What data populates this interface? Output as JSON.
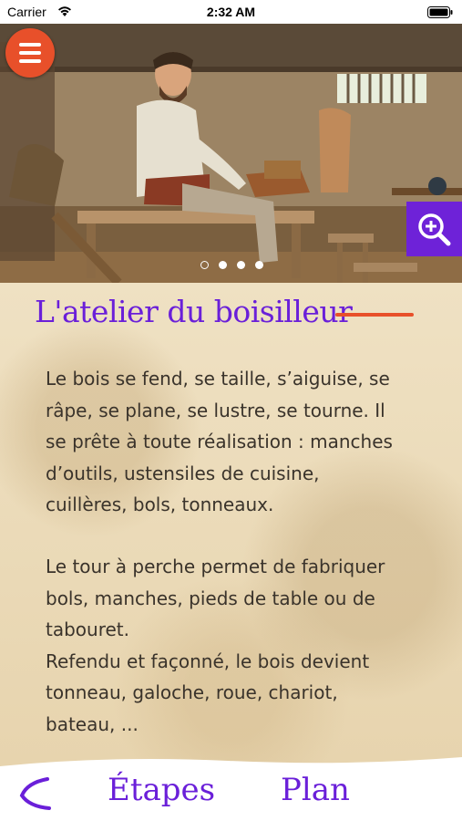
{
  "status_bar": {
    "carrier": "Carrier",
    "time": "2:32 AM"
  },
  "header": {
    "menu_icon": "hamburger-menu-icon",
    "zoom_icon": "zoom-in-icon",
    "carousel": {
      "count": 4,
      "active": 0
    }
  },
  "colors": {
    "accent": "#6a1fd9",
    "menu": "#e8502a",
    "zoom_bg": "#6e22d8"
  },
  "article": {
    "title": "L'atelier du boisilleur",
    "paragraphs": [
      [
        "Le bois se fend, se taille, s’aiguise, se",
        "râpe, se plane, se lustre, se tourne. Il",
        "se prête à toute réalisation : manches",
        "d’outils, ustensiles de cuisine,",
        "cuillères, bols, tonneaux."
      ],
      [
        "Le tour à perche permet de fabriquer",
        "bols, manches, pieds de table ou de",
        "tabouret.",
        "Refendu et façonné, le bois devient",
        "tonneau, galoche, roue, chariot,",
        "bateau, ..."
      ]
    ]
  },
  "bottom_nav": {
    "back_icon": "back-arrow-icon",
    "etapes_label": "Étapes",
    "plan_label": "Plan"
  }
}
